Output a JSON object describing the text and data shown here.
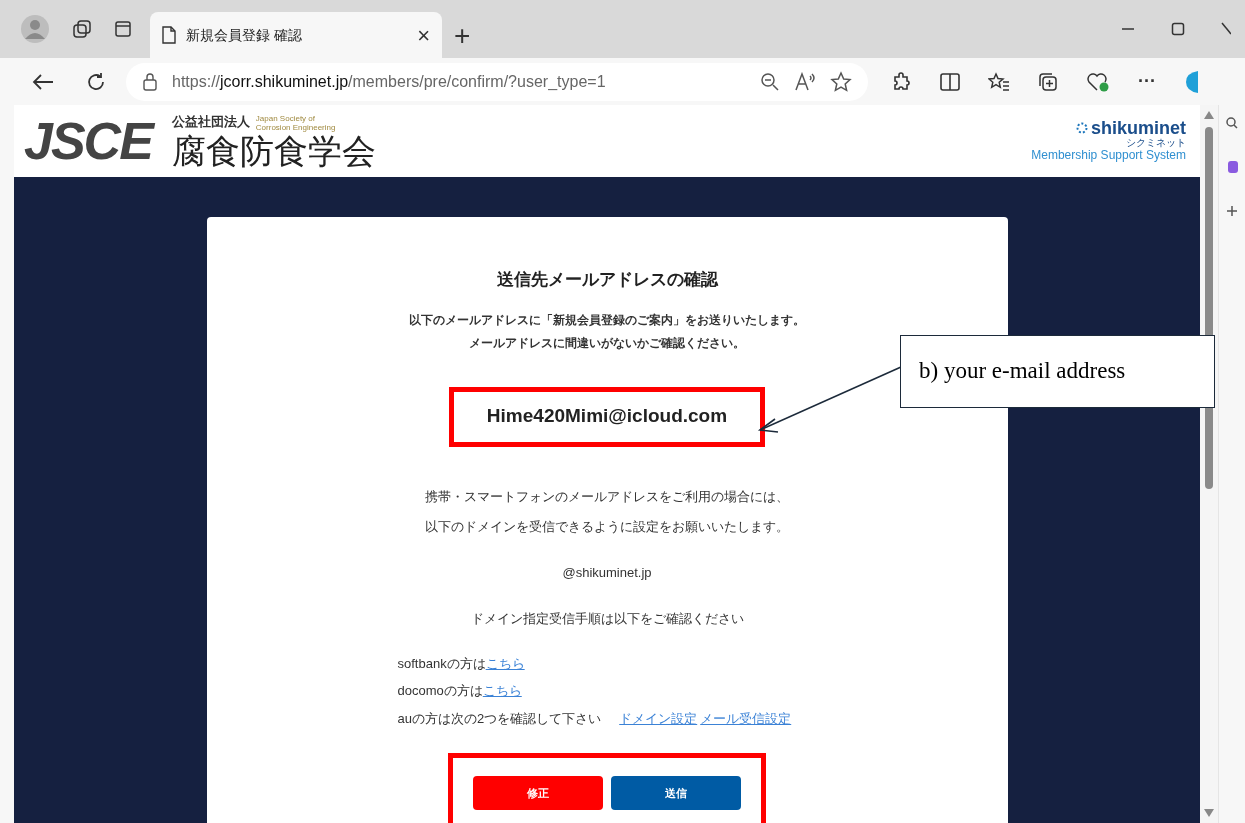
{
  "browser": {
    "tab_title": "新規会員登録 確認",
    "tab_close": "×",
    "new_tab": "+",
    "url_scheme": "https://",
    "url_host": "jcorr.shikuminet.jp",
    "url_path": "/members/pre/confirm/?user_type=1",
    "more": "···"
  },
  "header": {
    "logo": "JSCE",
    "org_type": "公益社団法人",
    "org_en": [
      "Japan Society of",
      "Corrosion Engineering"
    ],
    "org_name": "腐食防食学会",
    "brand": "shikuminet",
    "brand_kana": "シクミネット",
    "brand_sub": "Membership Support System"
  },
  "card": {
    "title": "送信先メールアドレスの確認",
    "intro": [
      "以下のメールアドレスに「新規会員登録のご案内」をお送りいたします。",
      "メールアドレスに間違いがないかご確認ください。"
    ],
    "email": "Hime420Mimi@icloud.com",
    "mobile_note": [
      "携帯・スマートフォンのメールアドレスをご利用の場合には、",
      "以下のドメインを受信できるように設定をお願いいたします。"
    ],
    "domain": "@shikuminet.jp",
    "procedure": "ドメイン指定受信手順は以下をご確認ください",
    "carriers": [
      {
        "text": "softbankの方は",
        "links": [
          "こちら"
        ]
      },
      {
        "text": "docomoの方は",
        "links": [
          "こちら"
        ]
      },
      {
        "text": "auの方は次の2つを確認して下さい",
        "links": [
          "ドメイン設定",
          "メール受信設定"
        ]
      }
    ],
    "buttons": [
      {
        "label": "修正",
        "kind": "danger"
      },
      {
        "label": "送信",
        "kind": "primary"
      }
    ]
  },
  "annotation": {
    "text": "b) your e-mail address"
  }
}
